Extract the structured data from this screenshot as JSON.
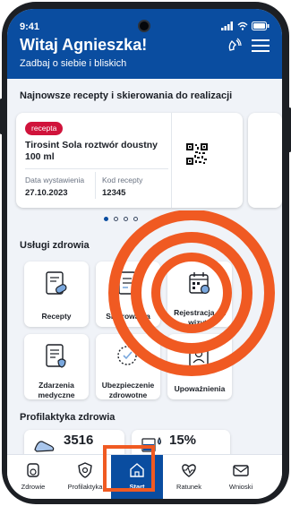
{
  "status": {
    "time": "9:41"
  },
  "header": {
    "greeting": "Witaj Agnieszka!",
    "subtitle": "Zadbaj o siebie i bliskich",
    "voice_icon": "voice-assistant-icon",
    "menu_icon": "hamburger-menu-icon"
  },
  "prescriptions": {
    "section_title": "Najnowsze recepty i skierowania do realizacji",
    "cards": [
      {
        "badge": "recepta",
        "name": "Tirosint Sola roztwór doustny 100 ml",
        "issue_label": "Data wystawienia",
        "issue_date": "27.10.2023",
        "code_label": "Kod recepty",
        "code": "12345"
      }
    ],
    "pagination": {
      "total": 4,
      "active": 1
    }
  },
  "services": {
    "section_title": "Usługi zdrowia",
    "tiles": [
      {
        "label": "Recepty",
        "icon": "prescription-icon"
      },
      {
        "label": "Skierowania",
        "icon": "referral-icon"
      },
      {
        "label": "Rejestracja na wizyty",
        "icon": "calendar-registration-icon"
      },
      {
        "label": "Zdarzenia medyczne",
        "icon": "medical-events-icon"
      },
      {
        "label": "Ubezpieczenie zdrowotne",
        "icon": "insurance-icon"
      },
      {
        "label": "Upoważnienia",
        "icon": "authorization-icon"
      }
    ]
  },
  "prevention": {
    "section_title": "Profilaktyka zdrowia",
    "stat1_value": "3516",
    "stat2_value": "15%"
  },
  "nav": {
    "items": [
      {
        "label": "Zdrowie",
        "icon": "health-icon"
      },
      {
        "label": "Profilaktyka",
        "icon": "prevention-shield-icon"
      },
      {
        "label": "Start",
        "icon": "home-icon"
      },
      {
        "label": "Ratunek",
        "icon": "heartbeat-icon"
      },
      {
        "label": "Wnioski",
        "icon": "applications-mail-icon"
      }
    ],
    "active": "Start"
  },
  "colors": {
    "brand_blue": "#0a4da0",
    "badge_red": "#d0133b",
    "accent_orange": "#f05a22"
  }
}
